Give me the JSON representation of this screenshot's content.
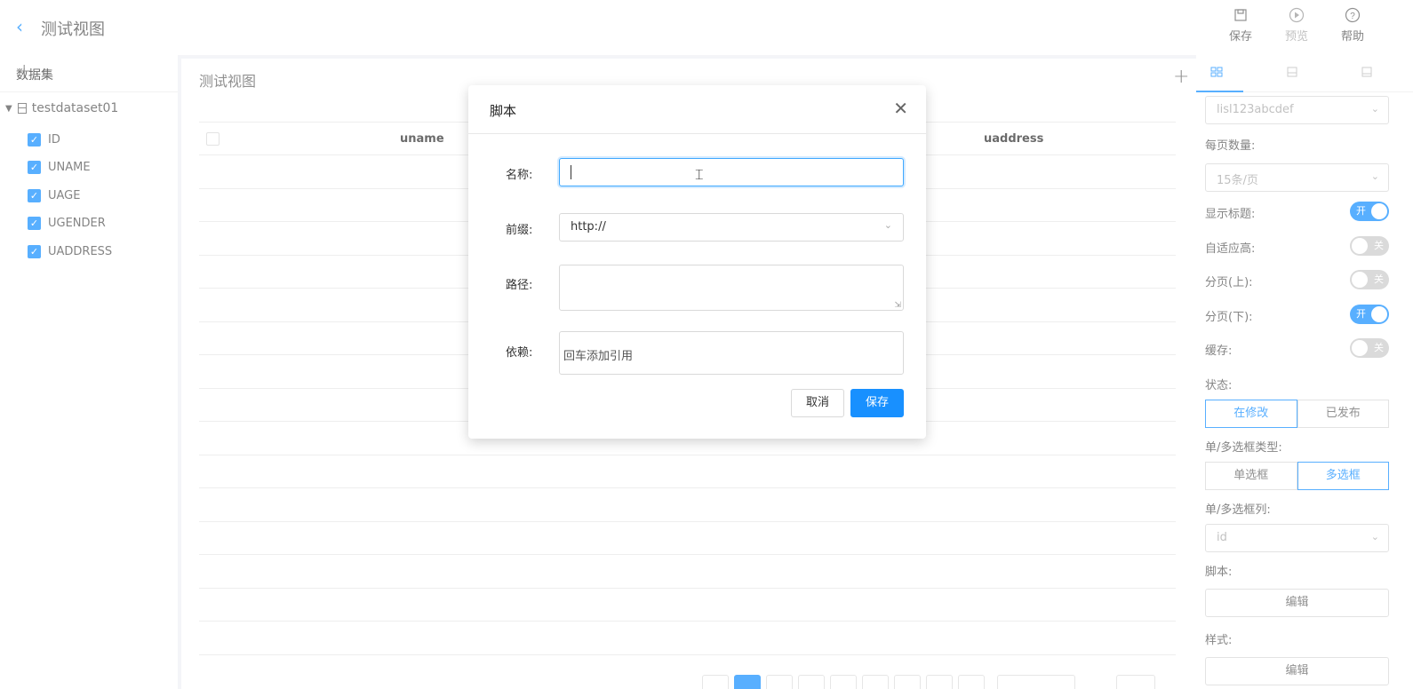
{
  "header": {
    "back_icon": "chevron-left-icon",
    "title": "测试视图",
    "tools": [
      {
        "label": "保存",
        "icon": "save-icon"
      },
      {
        "label": "预览",
        "icon": "play-circle-icon"
      },
      {
        "label": "帮助",
        "icon": "question-circle-icon"
      }
    ]
  },
  "left": {
    "title": "数据集",
    "dataset": "testdataset01",
    "fields": [
      "ID",
      "UNAME",
      "UAGE",
      "UGENDER",
      "UADDRESS"
    ]
  },
  "center": {
    "title": "测试视图",
    "columns": [
      "uname",
      "uaddress"
    ]
  },
  "right": {
    "datasource": "lisl123abcdef",
    "page_size_label": "每页数量:",
    "page_size": "15条/页",
    "switches": [
      {
        "label": "显示标题:",
        "state": "开",
        "on": true
      },
      {
        "label": "自适应高:",
        "state": "关",
        "on": false
      },
      {
        "label": "分页(上):",
        "state": "关",
        "on": false
      },
      {
        "label": "分页(下):",
        "state": "开",
        "on": true
      },
      {
        "label": "缓存:",
        "state": "关",
        "on": false
      }
    ],
    "status_label": "状态:",
    "status_options": [
      "在修改",
      "已发布"
    ],
    "checkbox_type_label": "单/多选框类型:",
    "checkbox_type_options": [
      "单选框",
      "多选框"
    ],
    "checkbox_col_label": "单/多选框列:",
    "checkbox_col": "id",
    "script_label": "脚本:",
    "script_btn": "编辑",
    "style_label": "样式:",
    "style_btn": "编辑"
  },
  "modal": {
    "title": "脚本",
    "name_label": "名称:",
    "name_value": "",
    "prefix_label": "前缀:",
    "prefix_value": "http://",
    "path_label": "路径:",
    "path_value": "",
    "deps_label": "依赖:",
    "deps_placeholder": "回车添加引用",
    "cancel": "取消",
    "save": "保存"
  },
  "colors": {
    "accent": "#1890ff"
  }
}
